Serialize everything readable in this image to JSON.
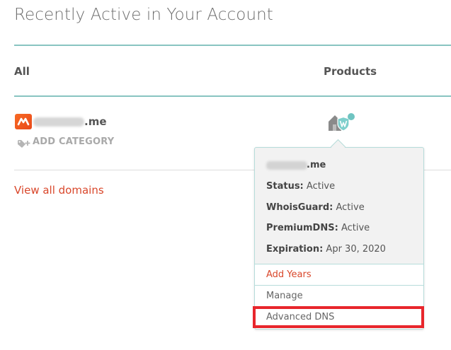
{
  "page": {
    "title": "Recently Active in Your Account"
  },
  "table": {
    "columns": {
      "all": "All",
      "products": "Products"
    }
  },
  "domain_row": {
    "domain_suffix": ".me",
    "add_category": "ADD CATEGORY",
    "icons": {
      "logo": "brand-logo-icon",
      "tag": "tag-add-icon",
      "product": "house-shield-icon"
    }
  },
  "links": {
    "view_all": "View all domains"
  },
  "popup": {
    "domain_suffix": ".me",
    "status_label": "Status:",
    "status_value": "Active",
    "whois_label": "WhoisGuard:",
    "whois_value": "Active",
    "premium_label": "PremiumDNS:",
    "premium_value": "Active",
    "expiration_label": "Expiration:",
    "expiration_value": "Apr 30, 2020",
    "actions": {
      "add_years": "Add Years",
      "manage": "Manage",
      "advanced_dns": "Advanced DNS"
    }
  },
  "colors": {
    "accent_teal": "#88c4c1",
    "link_red": "#d9472b",
    "highlight_red": "#e8262c",
    "logo_orange": "#f86a24"
  }
}
